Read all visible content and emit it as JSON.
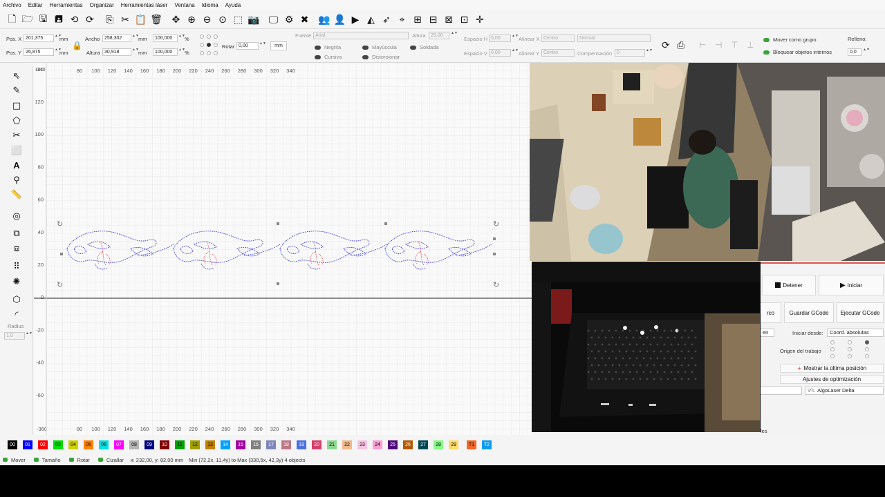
{
  "menu": [
    "Archivo",
    "Editar",
    "Herramientas",
    "Organizar",
    "Herramientas láser",
    "Ventana",
    "Idioma",
    "Ayuda"
  ],
  "toolbar_icons": [
    "new-file-icon",
    "open-folder-icon",
    "save-icon",
    "save-as-icon",
    "undo-icon",
    "redo-icon",
    "copy-icon",
    "cut-icon",
    "paste-icon",
    "delete-icon",
    "move-icon",
    "zoom-in-icon",
    "zoom-out-icon",
    "zoom-fit-icon",
    "select-rect-icon",
    "camera-icon",
    "monitor-icon",
    "settings-icon",
    "tools-icon",
    "group-icon",
    "user-icon",
    "play-arrow-icon",
    "trace-icon",
    "send-icon",
    "target-icon",
    "align-icon",
    "measure-icon",
    "distribute-icon",
    "grid-icon",
    "cross-icon"
  ],
  "props": {
    "posx_label": "Pos. X",
    "posx_value": "201,375",
    "posy_label": "Pos. Y",
    "posy_value": "26,875",
    "unit": "mm",
    "ancho_label": "Ancho",
    "ancho_value": "258,302",
    "altura_label": "Altura",
    "altura_value": "30,918",
    "pct1": "100,000",
    "pct2": "100,000",
    "pct_unit": "%",
    "rotar_label": "Rotar",
    "rotar_value": "0,00",
    "mm_button": "mm",
    "fuente_label": "Fuente",
    "fuente_value": "Arial",
    "altura_font_label": "Altura",
    "altura_font_value": "25,00",
    "negrita": "Negrita",
    "cursiva": "Cursiva",
    "mayuscula": "Mayúscula",
    "distorsionar": "Distorsionar",
    "soldada": "Soldada",
    "espacioh_label": "Espacio H",
    "espacioh_value": "0,00",
    "espaciov_label": "Espacio V",
    "espaciov_value": "0,00",
    "alinearx_label": "Alinear X",
    "alinearx_value": "Centro",
    "alineary_label": "Alinear Y",
    "alineary_value": "Centro",
    "normal_value": "Normal",
    "compensacion_label": "Compensación",
    "compensacion_value": "0",
    "mover_grupo": "Mover como grupo",
    "bloquear": "Bloquear objetos internos",
    "relleno_label": "Relleno:",
    "relleno_value": "0,0"
  },
  "left_tools": [
    "select-arrow-icon",
    "pen-icon",
    "rectangle-icon",
    "polygon-icon",
    "scissors-icon",
    "frame-icon",
    "text-icon",
    "pin-icon",
    "ruler-icon",
    "circle-icon",
    "copy-layers-icon",
    "array-icon",
    "grid-array-icon",
    "gear-icon",
    "node-icon",
    "corner-icon"
  ],
  "radius": {
    "label": "Radius",
    "value": "1,0"
  },
  "canvas": {
    "x_ticks": [
      "80",
      "100",
      "120",
      "140",
      "160",
      "180",
      "200",
      "220",
      "240",
      "260",
      "280",
      "300",
      "320",
      "340"
    ],
    "x_ticks_bottom": [
      "80",
      "100",
      "120",
      "140",
      "160",
      "180",
      "200",
      "220",
      "240",
      "260",
      "280",
      "300",
      "320",
      "340"
    ],
    "y_ticks": [
      "140",
      "120",
      "100",
      "80",
      "60",
      "40",
      "20",
      "0",
      "-20",
      "-40",
      "-60"
    ],
    "corner_top": "140",
    "corner_bottom": "-360"
  },
  "palette": [
    {
      "label": "00",
      "color": "#000000",
      "text": "#ffffff"
    },
    {
      "label": "01",
      "color": "#0000ff",
      "text": "#ffffff"
    },
    {
      "label": "02",
      "color": "#ff0000",
      "text": "#ffffff"
    },
    {
      "label": "03",
      "color": "#00e000",
      "text": "#000000"
    },
    {
      "label": "04",
      "color": "#d0d000",
      "text": "#000000"
    },
    {
      "label": "05",
      "color": "#ff8000",
      "text": "#000000"
    },
    {
      "label": "06",
      "color": "#00e0e0",
      "text": "#000000"
    },
    {
      "label": "07",
      "color": "#ff00ff",
      "text": "#ffffff"
    },
    {
      "label": "08",
      "color": "#b4b4b4",
      "text": "#000000"
    },
    {
      "label": "09",
      "color": "#000080",
      "text": "#ffffff"
    },
    {
      "label": "10",
      "color": "#800000",
      "text": "#ffffff"
    },
    {
      "label": "11",
      "color": "#00a000",
      "text": "#000000"
    },
    {
      "label": "12",
      "color": "#a0a000",
      "text": "#000000"
    },
    {
      "label": "13",
      "color": "#c08000",
      "text": "#000000"
    },
    {
      "label": "14",
      "color": "#00a0ff",
      "text": "#ffffff"
    },
    {
      "label": "15",
      "color": "#a000a0",
      "text": "#ffffff"
    },
    {
      "label": "16",
      "color": "#808080",
      "text": "#ffffff"
    },
    {
      "label": "17",
      "color": "#7d87b9",
      "text": "#ffffff"
    },
    {
      "label": "18",
      "color": "#bb7784",
      "text": "#ffffff"
    },
    {
      "label": "19",
      "color": "#4a6fe3",
      "text": "#ffffff"
    },
    {
      "label": "20",
      "color": "#d33f6a",
      "text": "#ffffff"
    },
    {
      "label": "21",
      "color": "#8cd78f",
      "text": "#000000"
    },
    {
      "label": "22",
      "color": "#f0b98d",
      "text": "#000000"
    },
    {
      "label": "23",
      "color": "#f6c4e1",
      "text": "#000000"
    },
    {
      "label": "24",
      "color": "#fa9ed4",
      "text": "#000000"
    },
    {
      "label": "25",
      "color": "#500a78",
      "text": "#ffffff"
    },
    {
      "label": "26",
      "color": "#b45a00",
      "text": "#ffffff"
    },
    {
      "label": "27",
      "color": "#004754",
      "text": "#ffffff"
    },
    {
      "label": "28",
      "color": "#86fa88",
      "text": "#000000"
    },
    {
      "label": "29",
      "color": "#ffdb66",
      "text": "#000000"
    },
    {
      "label": "T1",
      "color": "#f36926",
      "text": "#000000"
    },
    {
      "label": "T2",
      "color": "#0c9cef",
      "text": "#ffffff"
    }
  ],
  "status": {
    "mover": "Mover",
    "tamano": "Tamaño",
    "rotar": "Rotar",
    "cizallar": "Cizallar",
    "coords": "x: 232,00, y: 82,00 mm",
    "bounds": "Min (72,2x, 11,4y) to Max (330,5x, 42,3y)  4 objects"
  },
  "laser": {
    "detener": "Detener",
    "iniciar": "Iniciar",
    "arco": "rco",
    "guardar": "Guardar GCode",
    "ejecutar": "Ejecutar GCode",
    "en": "en",
    "iniciar_desde_label": "Iniciar desde:",
    "iniciar_desde_value": "Coord. absolutas",
    "origen_label": "Origen del trabajo",
    "mostrar": "Mostrar la última posición",
    "ajustes": "Ajustes de optimización",
    "device": "AlgoLaser Delta",
    "device_prefix": "9ªL",
    "tab_fragment": "les"
  }
}
